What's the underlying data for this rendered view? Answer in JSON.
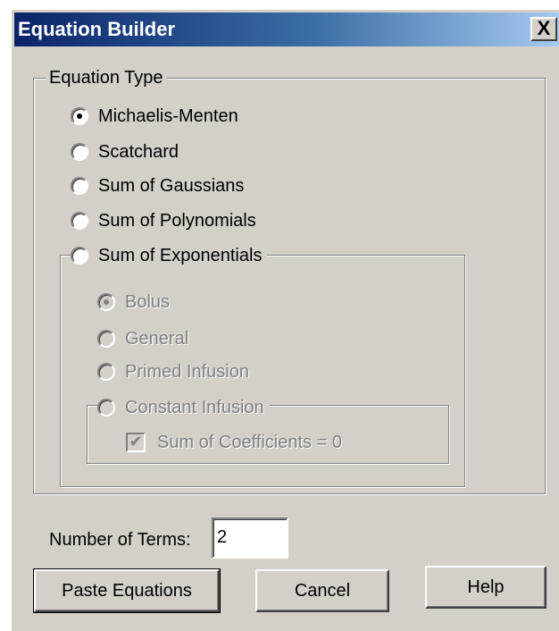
{
  "window": {
    "title": "Equation Builder",
    "close_glyph": "X"
  },
  "equation_type": {
    "legend": "Equation Type",
    "options": [
      {
        "label": "Michaelis-Menten",
        "checked": true
      },
      {
        "label": "Scatchard",
        "checked": false
      },
      {
        "label": "Sum of Gaussians",
        "checked": false
      },
      {
        "label": "Sum of Polynomials",
        "checked": false
      },
      {
        "label": "Sum of Exponentials",
        "checked": false
      }
    ]
  },
  "exponentials": {
    "enabled": false,
    "options": [
      {
        "label": "Bolus",
        "checked": true
      },
      {
        "label": "General",
        "checked": false
      },
      {
        "label": "Primed Infusion",
        "checked": false
      },
      {
        "label": "Constant Infusion",
        "checked": false
      }
    ],
    "sum_of_coefficients": {
      "label": "Sum of Coefficients = 0",
      "checked": true
    }
  },
  "terms": {
    "label": "Number of Terms:",
    "value": "2"
  },
  "buttons": {
    "paste": "Paste Equations",
    "cancel": "Cancel",
    "help": "Help"
  }
}
